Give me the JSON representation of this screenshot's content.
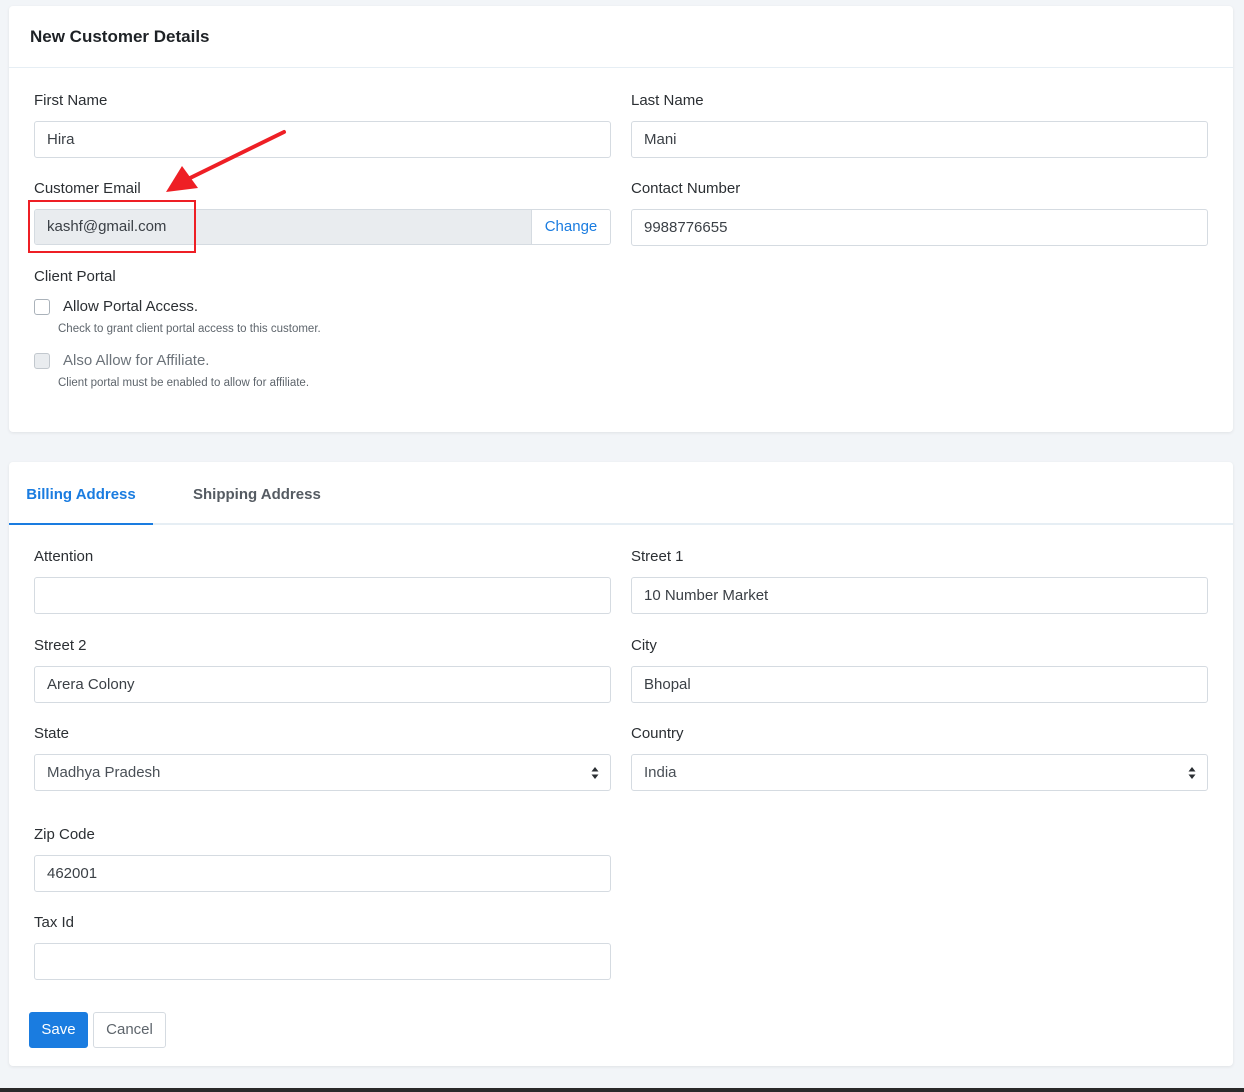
{
  "customer_details": {
    "title": "New Customer Details",
    "first_name": {
      "label": "First Name",
      "value": "Hira"
    },
    "last_name": {
      "label": "Last Name",
      "value": "Mani"
    },
    "email": {
      "label": "Customer Email",
      "value": "kashf@gmail.com",
      "change_label": "Change"
    },
    "contact": {
      "label": "Contact Number",
      "value": "9988776655"
    },
    "client_portal": {
      "label": "Client Portal",
      "allow_access": {
        "label": "Allow Portal Access.",
        "hint": "Check to grant client portal access to this customer.",
        "checked": false
      },
      "affiliate": {
        "label": "Also Allow for Affiliate.",
        "hint": "Client portal must be enabled to allow for affiliate.",
        "checked": false,
        "disabled": true
      }
    }
  },
  "address": {
    "tabs": [
      {
        "label": "Billing Address",
        "active": true
      },
      {
        "label": "Shipping Address",
        "active": false
      }
    ],
    "attention": {
      "label": "Attention",
      "value": ""
    },
    "street1": {
      "label": "Street 1",
      "value": "10 Number Market"
    },
    "street2": {
      "label": "Street 2",
      "value": "Arera Colony"
    },
    "city": {
      "label": "City",
      "value": "Bhopal"
    },
    "state": {
      "label": "State",
      "value": "Madhya Pradesh"
    },
    "country": {
      "label": "Country",
      "value": "India"
    },
    "zip": {
      "label": "Zip Code",
      "value": "462001"
    },
    "tax_id": {
      "label": "Tax Id",
      "value": ""
    }
  },
  "actions": {
    "save_label": "Save",
    "cancel_label": "Cancel"
  },
  "colors": {
    "accent": "#1a7ce0",
    "annotation": "#ee1f25",
    "page_bg": "#f2f5f8"
  },
  "icons": {
    "select_arrows": "sort-arrows-icon",
    "annotation": "red-arrow-icon"
  }
}
